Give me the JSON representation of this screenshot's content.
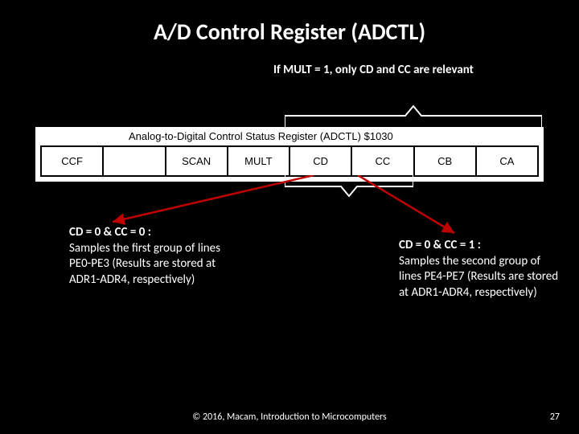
{
  "title": "A/D Control Register (ADCTL)",
  "note_top": "If MULT = 1, only CD and CC are relevant",
  "register": {
    "caption": "Analog-to-Digital Control Status Register (ADCTL) $1030",
    "bits": [
      "CCF",
      "",
      "SCAN",
      "MULT",
      "CD",
      "CC",
      "CB",
      "CA"
    ]
  },
  "block_left": {
    "heading": "CD = 0 & CC = 0 :",
    "body": "Samples the first group of lines PE0-PE3 (Results are stored at ADR1-ADR4, respectively)"
  },
  "block_right": {
    "heading": "CD = 0 & CC = 1 :",
    "body": "Samples the second group of lines PE4-PE7 (Results are stored at ADR1-ADR4, respectively)"
  },
  "footer": "© 2016, Macam, Introduction to Microcomputers",
  "page_number": "27"
}
